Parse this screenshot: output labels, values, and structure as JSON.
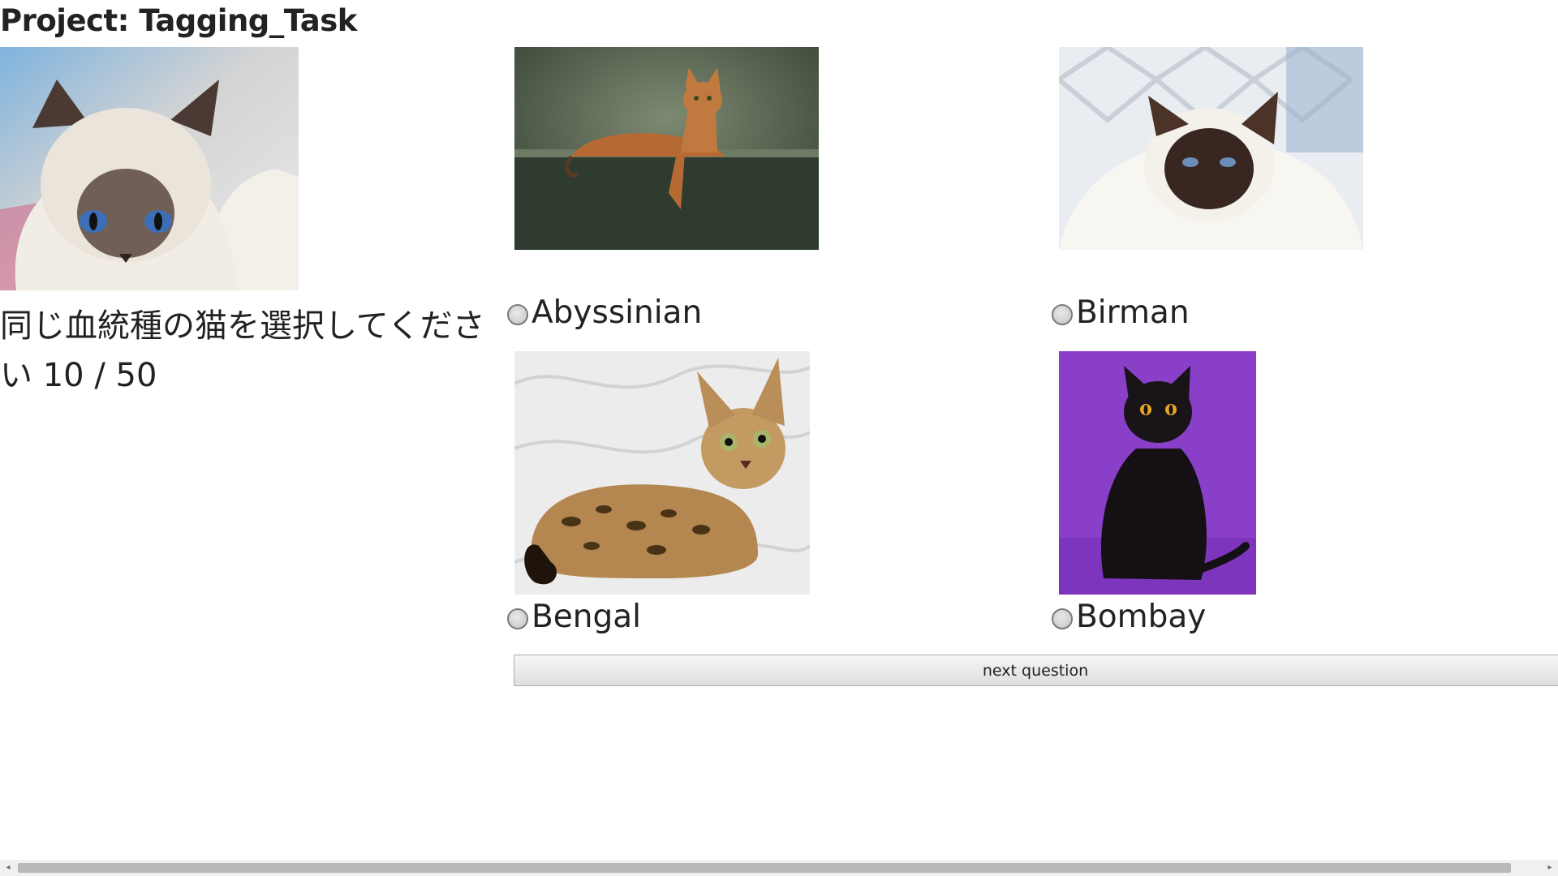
{
  "page": {
    "title": "Project: Tagging_Task"
  },
  "question": {
    "text": "同じ血統種の猫を選択してください 10 / 50"
  },
  "options": [
    {
      "label": "Abyssinian",
      "image": "cat-photo-abyssinian"
    },
    {
      "label": "Birman",
      "image": "cat-photo-birman"
    },
    {
      "label": "Bengal",
      "image": "cat-photo-bengal"
    },
    {
      "label": "Bombay",
      "image": "cat-photo-bombay"
    }
  ],
  "next_button": {
    "label": "next question"
  },
  "colors": {
    "background": "#ffffff",
    "text": "#222222",
    "bombay_backdrop": "#8a3fc8"
  },
  "icons": {
    "radio": "radio-unchecked-icon",
    "scroll_left": "scroll-left-arrow-icon",
    "scroll_right": "scroll-right-arrow-icon"
  }
}
